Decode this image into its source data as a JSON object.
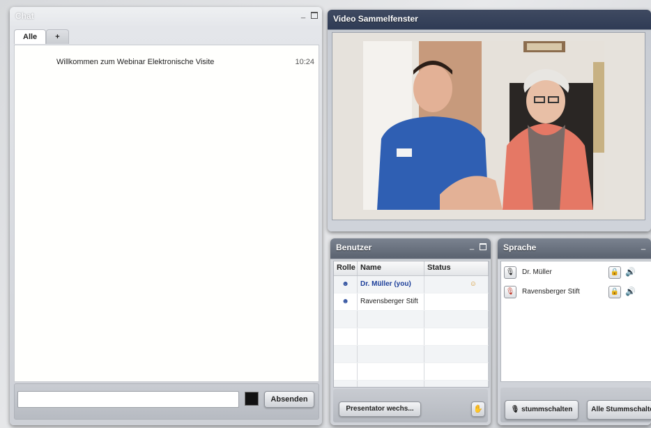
{
  "chat": {
    "title": "Chat",
    "tabs": [
      "Alle",
      "+"
    ],
    "messages": [
      {
        "text": "Willkommen zum Webinar Elektronische Visite",
        "time": "10:24"
      }
    ],
    "send_label": "Absenden"
  },
  "video": {
    "title": "Video Sammelfenster"
  },
  "users": {
    "title": "Benutzer",
    "columns": [
      "Rolle",
      "Name",
      "Status"
    ],
    "rows": [
      {
        "name": "Dr. Müller (you)"
      },
      {
        "name": "Ravensberger Stift"
      }
    ],
    "presenter_label": "Presentator wechs..."
  },
  "speech": {
    "title": "Sprache",
    "rows": [
      {
        "name": "Dr. Müller"
      },
      {
        "name": "Ravensberger Stift"
      }
    ],
    "mute_label": "stummschalten",
    "mute_all_label": "Alle Stummschalte"
  },
  "colors": {
    "accent_blue": "#1d3f9a",
    "title_bar": "#2f3b55",
    "speaker_red": "#c0392b"
  },
  "icons": [
    "minimize-icon",
    "maximize-icon",
    "presenter-icon",
    "participant-icon",
    "status-person-icon",
    "microphone-icon",
    "microphone-muted-icon",
    "lock-icon",
    "speaker-icon",
    "hand-icon"
  ]
}
